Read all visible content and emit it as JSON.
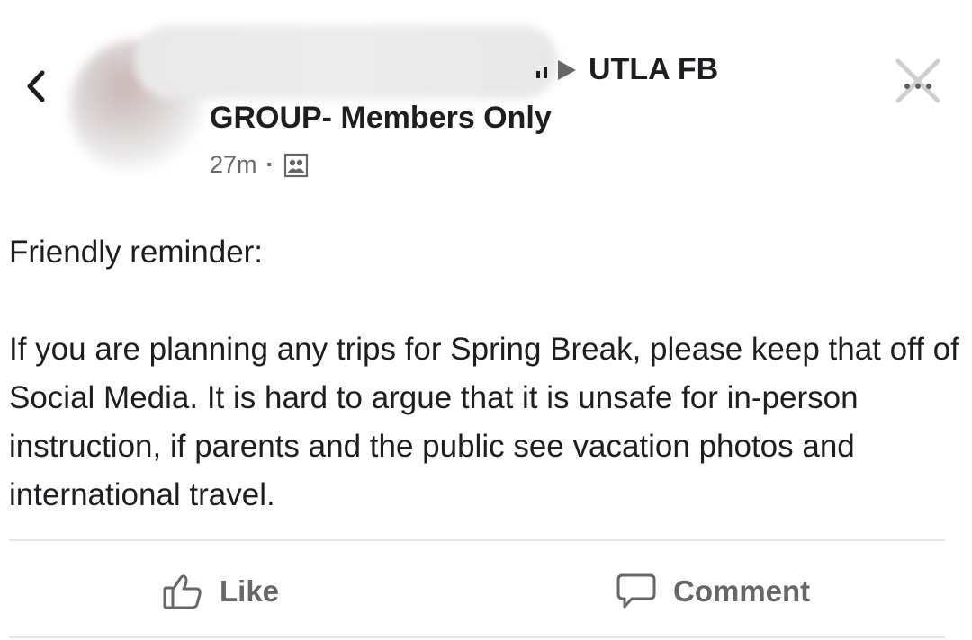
{
  "header": {
    "breadcrumb_target": "UTLA FB",
    "group_name": "GROUP- Members Only",
    "timestamp": "27m",
    "separator": "·",
    "privacy_icon": "group-members-icon",
    "back_icon": "chevron-left-icon",
    "close_icon": "close-icon"
  },
  "post": {
    "greeting": "Friendly reminder:",
    "body": "If you are planning any trips for Spring Break, please keep that off of Social Media.  It is hard to argue that it is unsafe for in-person instruction, if parents and the public see vacation photos and international travel."
  },
  "actions": {
    "like_label": "Like",
    "like_icon": "thumbs-up-icon",
    "comment_label": "Comment",
    "comment_icon": "speech-bubble-icon"
  },
  "colors": {
    "text_primary": "#1c1e21",
    "text_secondary": "#65676b",
    "divider": "#e4e6eb"
  }
}
